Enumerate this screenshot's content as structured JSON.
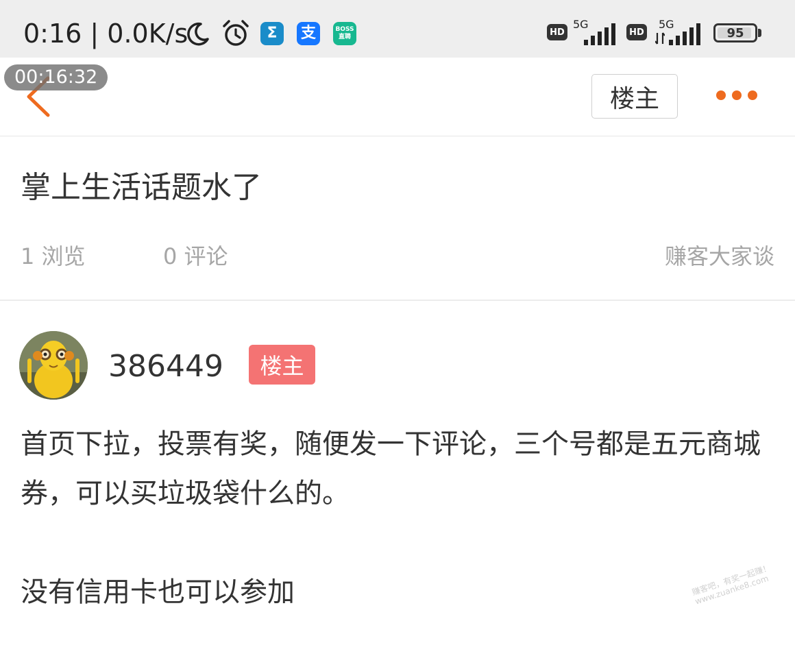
{
  "status_bar": {
    "time": "0:16 | 0.0K/s",
    "app_icons": [
      {
        "name": "sigma-app-icon",
        "glyph": "Σ",
        "color": "#1a8cc9"
      },
      {
        "name": "alipay-app-icon",
        "glyph": "支",
        "color": "#1677ff"
      },
      {
        "name": "boss-app-icon",
        "line1": "BOSS",
        "line2": "直聘",
        "color": "#17b890"
      }
    ],
    "network": [
      {
        "hd": "HD",
        "type": "5G"
      },
      {
        "hd": "HD",
        "type": "5G"
      }
    ],
    "battery": "95"
  },
  "overlay": {
    "timer": "00:16:32"
  },
  "nav": {
    "louzhu_button": "楼主",
    "accent_color": "#ee6b1f"
  },
  "post": {
    "title": "掌上生活话题水了",
    "views": "1 浏览",
    "comments": "0 评论",
    "forum": "赚客大家谈",
    "author": {
      "name": "386449",
      "badge": "楼主"
    },
    "body": "首页下拉，投票有奖，随便发一下评论，三个号都是五元商城券，可以买垃圾袋什么的。\n\n没有信用卡也可以参加"
  },
  "watermark": {
    "line1": "赚客吧，有奖一起赚！",
    "line2": "www.zuanke8.com"
  }
}
